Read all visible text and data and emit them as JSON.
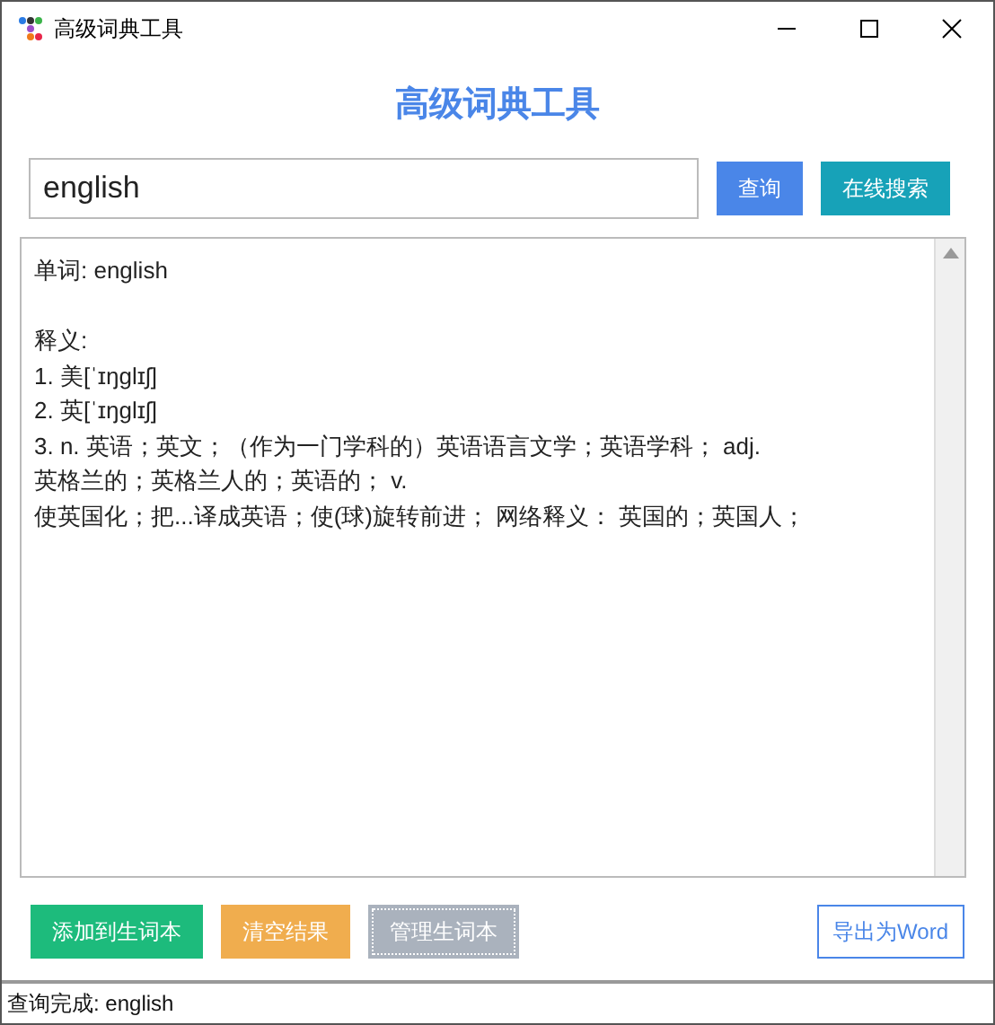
{
  "window": {
    "title": "高级词典工具"
  },
  "heading": "高级词典工具",
  "search": {
    "value": "english",
    "buttons": [
      {
        "label": "查询",
        "color": "#4a86e8"
      },
      {
        "label": "在线搜索",
        "color": "#17a2b8"
      }
    ]
  },
  "result_paragraphs": [
    {
      "lines": [
        "单词: english"
      ]
    },
    {
      "lines": [
        "释义:",
        "1. 美[ˈɪŋglɪʃ]",
        "2. 英[ˈɪŋglɪʃ]",
        "3. n. 英语；英文；（作为一门学科的）英语语言文学；英语学科； adj.",
        "英格兰的；英格兰人的；英语的； v.",
        "使英国化；把...译成英语；使(球)旋转前进； 网络释义： 英国的；英国人；"
      ]
    }
  ],
  "actions": [
    {
      "label": "添加到生词本",
      "color": "#1dbb7c",
      "kind": "filled",
      "focused": false
    },
    {
      "label": "清空结果",
      "color": "#f0ad4e",
      "kind": "filled",
      "focused": false
    },
    {
      "label": "管理生词本",
      "color": "#aab2bd",
      "kind": "filled",
      "focused": true
    },
    {
      "label": "导出为Word",
      "color": "#4a86e8",
      "kind": "outline",
      "focused": false
    }
  ],
  "status_bar": "查询完成: english"
}
